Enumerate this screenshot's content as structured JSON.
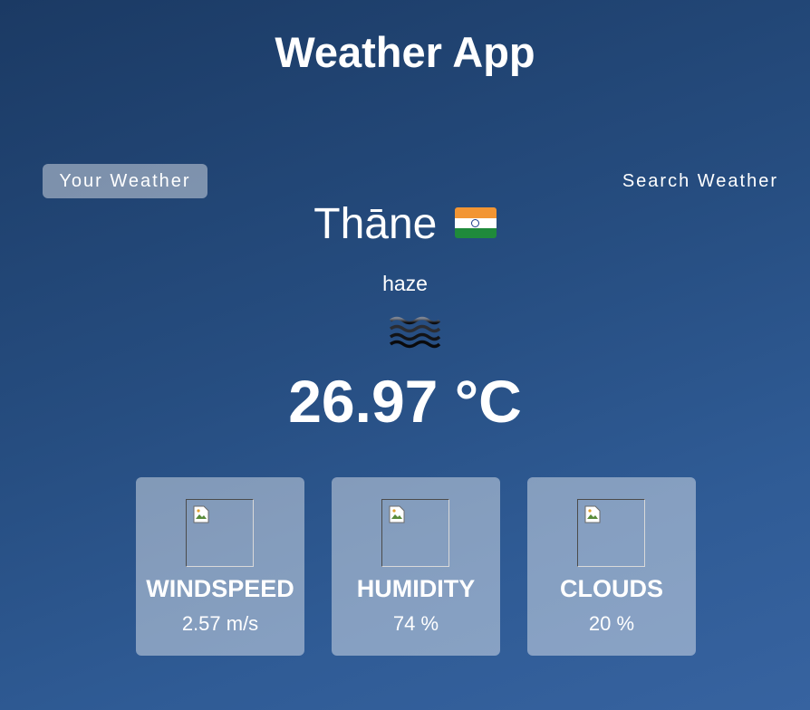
{
  "app": {
    "title": "Weather App"
  },
  "tabs": {
    "your_weather": "Your Weather",
    "search_weather": "Search Weather"
  },
  "weather": {
    "city": "Thāne",
    "country_flag": "India",
    "description": "haze",
    "icon": "haze-icon",
    "temperature": "26.97 °C"
  },
  "stats": [
    {
      "label": "WINDSPEED",
      "value": "2.57 m/s",
      "icon": "broken-image-icon"
    },
    {
      "label": "HUMIDITY",
      "value": "74 %",
      "icon": "broken-image-icon"
    },
    {
      "label": "CLOUDS",
      "value": "20 %",
      "icon": "broken-image-icon"
    }
  ],
  "colors": {
    "background_top": "#1b3a64",
    "background_bottom": "#3763a0",
    "card": "rgba(255,255,255,0.42)",
    "text": "#ffffff"
  }
}
